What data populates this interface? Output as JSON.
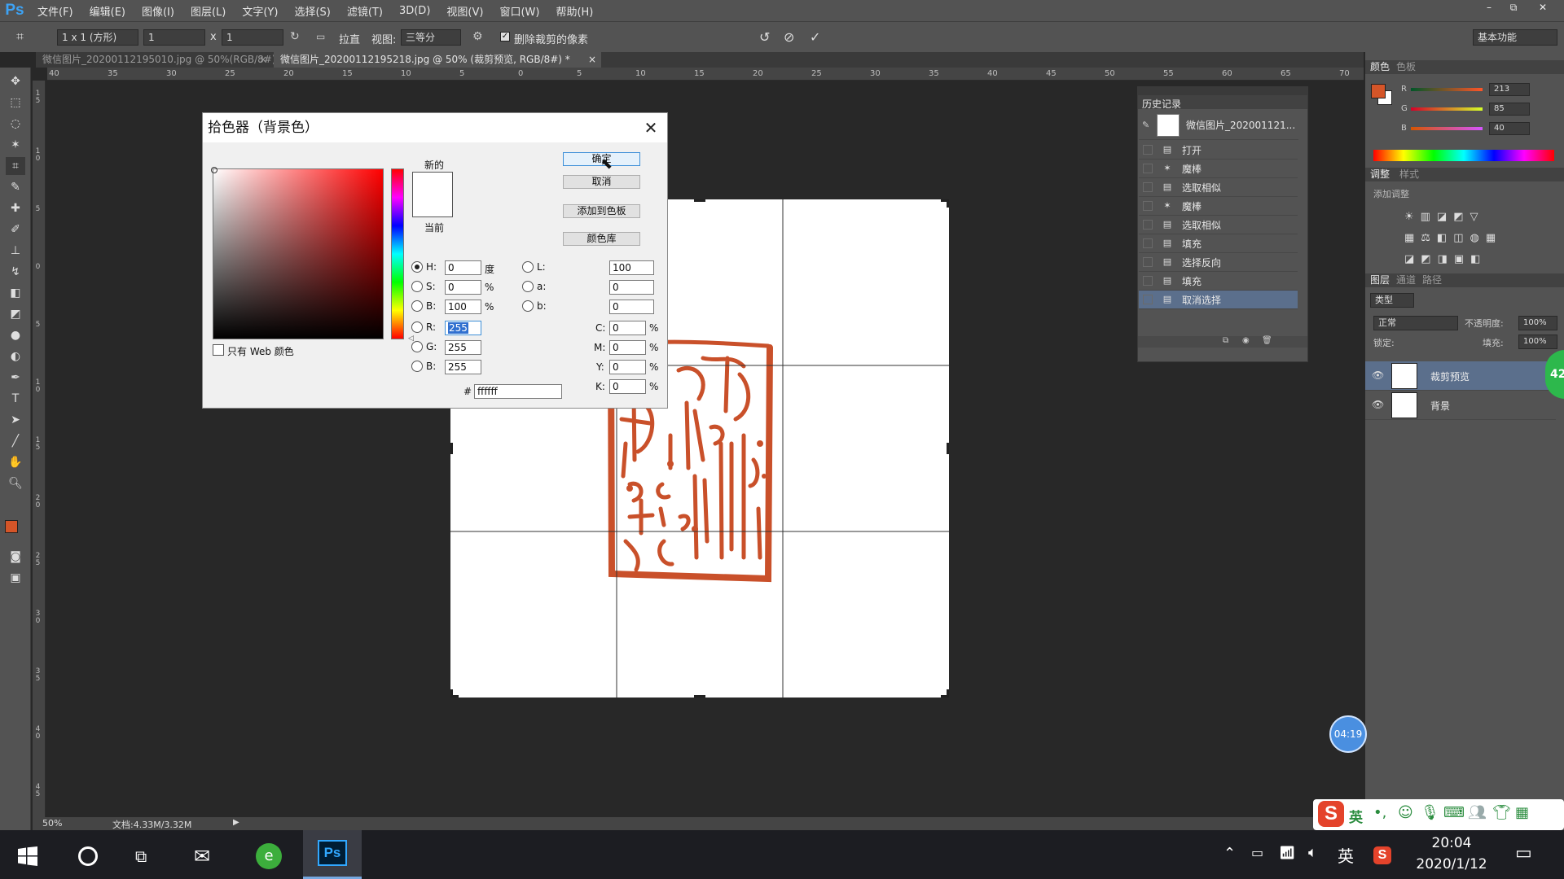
{
  "app": {
    "logo": "Ps",
    "menu": [
      "文件(F)",
      "编辑(E)",
      "图像(I)",
      "图层(L)",
      "文字(Y)",
      "选择(S)",
      "滤镜(T)",
      "3D(D)",
      "视图(V)",
      "窗口(W)",
      "帮助(H)"
    ],
    "window_buttons": [
      "–",
      "⧉",
      "✕"
    ]
  },
  "options": {
    "ratio": "1 x 1 (方形)",
    "width_value": "1",
    "times": "x",
    "height_value": "1",
    "straighten": "拉直",
    "view_label": "视图:",
    "view_value": "三等分",
    "delete_cropped": "删除裁剪的像素",
    "workspace": "基本功能"
  },
  "tabs": [
    {
      "label": "微信图片_20200112195010.jpg @ 50%(RGB/8#)",
      "close": "×"
    },
    {
      "label": "微信图片_20200112195218.jpg @ 50% (裁剪预览, RGB/8#) *",
      "close": "×"
    }
  ],
  "ruler_top": [
    "40",
    "35",
    "30",
    "25",
    "20",
    "15",
    "10",
    "5",
    "0",
    "5",
    "10",
    "15",
    "20",
    "25",
    "30",
    "35",
    "40",
    "45",
    "50",
    "55",
    "60",
    "65",
    "70"
  ],
  "ruler_left": [
    "1 5",
    "1 0",
    "5",
    "0",
    "5",
    "1 0",
    "1 5",
    "2 0",
    "2 5",
    "3 0",
    "3 5",
    "4 0",
    "4 5"
  ],
  "status": {
    "zoom": "50%",
    "doc_size": "文档:4.33M/3.32M"
  },
  "color_picker": {
    "title": "拾色器（背景色）",
    "new_label": "新的",
    "current_label": "当前",
    "ok": "确定",
    "cancel": "取消",
    "add_swatch": "添加到色板",
    "color_library": "颜色库",
    "only_web": "只有 Web 颜色",
    "hsb": [
      {
        "label": "H:",
        "value": "0",
        "unit": "度",
        "selected": true
      },
      {
        "label": "S:",
        "value": "0",
        "unit": "%",
        "selected": false
      },
      {
        "label": "B:",
        "value": "100",
        "unit": "%",
        "selected": false
      }
    ],
    "rgb": [
      {
        "label": "R:",
        "value": "255"
      },
      {
        "label": "G:",
        "value": "255"
      },
      {
        "label": "B:",
        "value": "255"
      }
    ],
    "lab": [
      {
        "label": "L:",
        "value": "100"
      },
      {
        "label": "a:",
        "value": "0"
      },
      {
        "label": "b:",
        "value": "0"
      }
    ],
    "cmyk": [
      {
        "label": "C:",
        "value": "0",
        "unit": "%"
      },
      {
        "label": "M:",
        "value": "0",
        "unit": "%"
      },
      {
        "label": "Y:",
        "value": "0",
        "unit": "%"
      },
      {
        "label": "K:",
        "value": "0",
        "unit": "%"
      }
    ],
    "hex_label": "#",
    "hex": "ffffff",
    "new_color": "#ffffff",
    "current_color": "#ffffff"
  },
  "history": {
    "title": "历史记录",
    "snapshot": "微信图片_202001121...",
    "items": [
      "打开",
      "魔棒",
      "选取相似",
      "魔棒",
      "选取相似",
      "填充",
      "选择反向",
      "填充",
      "取消选择"
    ],
    "selected_index": 8
  },
  "color_panel": {
    "tabs": [
      "颜色",
      "色板"
    ],
    "r_label": "R",
    "r_value": "213",
    "g_label": "G",
    "g_value": "85",
    "b_label": "B",
    "b_value": "40",
    "foreground": "#d55528",
    "background": "#ffffff"
  },
  "adjust_panel": {
    "tabs": [
      "调整",
      "样式"
    ],
    "add_label": "添加调整"
  },
  "layers_panel": {
    "tabs": [
      "图层",
      "通道",
      "路径"
    ],
    "filter": "类型",
    "blend": "正常",
    "opacity_label": "不透明度:",
    "opacity": "100%",
    "lock_label": "锁定:",
    "fill_label": "填充:",
    "fill": "100%",
    "layers": [
      {
        "name": "裁剪预览",
        "selected": true
      },
      {
        "name": "背景",
        "selected": false
      }
    ],
    "badge": "42"
  },
  "overlay": {
    "timer": "04:19"
  },
  "ime": {
    "logo": "S",
    "lang": "英",
    "icons": [
      "punctuation-icon",
      "emoji-icon",
      "mic-icon",
      "keyboard-icon",
      "user-icon",
      "shirt-icon",
      "grid-icon"
    ]
  },
  "taskbar": {
    "time": "20:04",
    "date": "2020/1/12",
    "lang": "英",
    "ps_label": "Ps"
  },
  "colors": {
    "seal": "#c9502a",
    "accent": "#3da3f5",
    "selection": "#5b6f8c"
  }
}
